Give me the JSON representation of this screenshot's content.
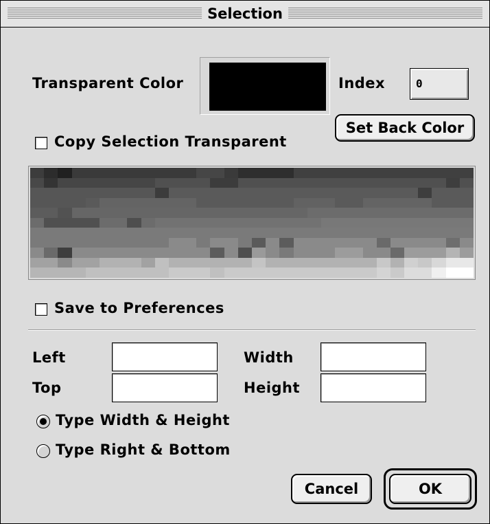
{
  "window": {
    "title": "Selection"
  },
  "transparent": {
    "label": "Transparent Color",
    "color": "#000000",
    "index_label": "Index",
    "index_value": "0",
    "set_back_color_label": "Set Back Color"
  },
  "copy_transparent": {
    "label": "Copy Selection Transparent",
    "checked": false
  },
  "preview": {
    "description": "pixelated grayscale gradient preview",
    "rows": [
      [
        "#3c3c3c",
        "#2c2c2c",
        "#202020",
        "#3a3a3a",
        "#3a3a3a",
        "#3a3a3a",
        "#3a3a3a",
        "#3a3a3a",
        "#3a3a3a",
        "#3a3a3a",
        "#3a3a3a",
        "#3a3a3a",
        "#464646",
        "#464646",
        "#3a3a3a",
        "#2e2e2e",
        "#2e2e2e",
        "#2e2e2e",
        "#2e2e2e",
        "#404040",
        "#404040",
        "#404040",
        "#404040",
        "#404040",
        "#404040",
        "#404040",
        "#404040",
        "#404040",
        "#404040",
        "#404040",
        "#404040",
        "#404040"
      ],
      [
        "#484848",
        "#343434",
        "#464646",
        "#464646",
        "#464646",
        "#464646",
        "#464646",
        "#464646",
        "#464646",
        "#505050",
        "#505050",
        "#505050",
        "#505050",
        "#3c3c3c",
        "#3c3c3c",
        "#505050",
        "#505050",
        "#505050",
        "#505050",
        "#505050",
        "#505050",
        "#505050",
        "#505050",
        "#505050",
        "#505050",
        "#505050",
        "#505050",
        "#505050",
        "#505050",
        "#505050",
        "#3e3e3e",
        "#505050"
      ],
      [
        "#565656",
        "#565656",
        "#565656",
        "#565656",
        "#565656",
        "#565656",
        "#565656",
        "#565656",
        "#565656",
        "#3c3c3c",
        "#5a5a5a",
        "#5a5a5a",
        "#5a5a5a",
        "#5a5a5a",
        "#5a5a5a",
        "#5a5a5a",
        "#5a5a5a",
        "#5a5a5a",
        "#5a5a5a",
        "#5a5a5a",
        "#5a5a5a",
        "#5a5a5a",
        "#5a5a5a",
        "#5a5a5a",
        "#5a5a5a",
        "#5a5a5a",
        "#5a5a5a",
        "#5a5a5a",
        "#3e3e3e",
        "#5a5a5a",
        "#5a5a5a",
        "#5a5a5a"
      ],
      [
        "#565656",
        "#565656",
        "#565656",
        "#565656",
        "#5a5a5a",
        "#646464",
        "#646464",
        "#646464",
        "#646464",
        "#646464",
        "#646464",
        "#646464",
        "#5a5a5a",
        "#5a5a5a",
        "#5a5a5a",
        "#5a5a5a",
        "#5a5a5a",
        "#5a5a5a",
        "#5a5a5a",
        "#626262",
        "#626262",
        "#626262",
        "#5a5a5a",
        "#5a5a5a",
        "#646464",
        "#646464",
        "#646464",
        "#646464",
        "#646464",
        "#5a5a5a",
        "#5a5a5a",
        "#5a5a5a"
      ],
      [
        "#5c5c5c",
        "#5c5c5c",
        "#525252",
        "#666666",
        "#666666",
        "#666666",
        "#666666",
        "#666666",
        "#666666",
        "#666666",
        "#666666",
        "#666666",
        "#666666",
        "#666666",
        "#666666",
        "#666666",
        "#666666",
        "#666666",
        "#666666",
        "#666666",
        "#6c6c6c",
        "#6c6c6c",
        "#6c6c6c",
        "#6c6c6c",
        "#6c6c6c",
        "#6c6c6c",
        "#6c6c6c",
        "#6c6c6c",
        "#6c6c6c",
        "#6c6c6c",
        "#6c6c6c",
        "#6c6c6c"
      ],
      [
        "#6c6c6c",
        "#505050",
        "#505050",
        "#505050",
        "#505050",
        "#6c6c6c",
        "#6c6c6c",
        "#4e4e4e",
        "#6c6c6c",
        "#727272",
        "#727272",
        "#727272",
        "#727272",
        "#727272",
        "#727272",
        "#727272",
        "#727272",
        "#727272",
        "#727272",
        "#727272",
        "#727272",
        "#787878",
        "#787878",
        "#787878",
        "#787878",
        "#787878",
        "#787878",
        "#787878",
        "#787878",
        "#787878",
        "#787878",
        "#787878"
      ],
      [
        "#7a7a7a",
        "#7a7a7a",
        "#7a7a7a",
        "#7a7a7a",
        "#7a7a7a",
        "#7a7a7a",
        "#7a7a7a",
        "#7a7a7a",
        "#7a7a7a",
        "#7a7a7a",
        "#7a7a7a",
        "#7a7a7a",
        "#7a7a7a",
        "#7a7a7a",
        "#7a7a7a",
        "#7a7a7a",
        "#7a7a7a",
        "#7a7a7a",
        "#7a7a7a",
        "#7a7a7a",
        "#7a7a7a",
        "#7a7a7a",
        "#7a7a7a",
        "#7a7a7a",
        "#7a7a7a",
        "#7a7a7a",
        "#7a7a7a",
        "#7a7a7a",
        "#7a7a7a",
        "#7a7a7a",
        "#7a7a7a",
        "#7a7a7a"
      ],
      [
        "#7a7a7a",
        "#7a7a7a",
        "#7a7a7a",
        "#7a7a7a",
        "#7a7a7a",
        "#7a7a7a",
        "#7a7a7a",
        "#7a7a7a",
        "#7a7a7a",
        "#7a7a7a",
        "#8a8a8a",
        "#8a8a8a",
        "#7a7a7a",
        "#8a8a8a",
        "#8a8a8a",
        "#7a7a7a",
        "#5a5a5a",
        "#8a8a8a",
        "#5c5c5c",
        "#8a8a8a",
        "#8a8a8a",
        "#8a8a8a",
        "#8a8a8a",
        "#8a8a8a",
        "#8a8a8a",
        "#6a6a6a",
        "#8a8a8a",
        "#8a8a8a",
        "#8a8a8a",
        "#8a8a8a",
        "#6e6e6e",
        "#8a8a8a"
      ],
      [
        "#8a8a8a",
        "#6a6a6a",
        "#3e3e3e",
        "#8a8a8a",
        "#8a8a8a",
        "#8a8a8a",
        "#8a8a8a",
        "#8a8a8a",
        "#8a8a8a",
        "#8a8a8a",
        "#8a8a8a",
        "#8a8a8a",
        "#8a8a8a",
        "#5c5c5c",
        "#8a8a8a",
        "#4e4e4e",
        "#9a9a9a",
        "#8a8a8a",
        "#7a7a7a",
        "#8a8a8a",
        "#8a8a8a",
        "#8a8a8a",
        "#9c9c9c",
        "#9c9c9c",
        "#8a8a8a",
        "#8a8a8a",
        "#6a6a6a",
        "#9c9c9c",
        "#9c9c9c",
        "#9c9c9c",
        "#b4b4b4",
        "#9c9c9c"
      ],
      [
        "#a2a2a2",
        "#a2a2a2",
        "#8a8a8a",
        "#a2a2a2",
        "#a2a2a2",
        "#b2b2b2",
        "#b2b2b2",
        "#b2b2b2",
        "#a2a2a2",
        "#c0c0c0",
        "#b2b2b2",
        "#b2b2b2",
        "#b2b2b2",
        "#b2b2b2",
        "#b2b2b2",
        "#b2b2b2",
        "#c4c4c4",
        "#b2b2b2",
        "#b2b2b2",
        "#b2b2b2",
        "#b2b2b2",
        "#b2b2b2",
        "#b2b2b2",
        "#b2b2b2",
        "#b2b2b2",
        "#c8c8c8",
        "#b2b2b2",
        "#d0d0d0",
        "#c8c8c8",
        "#d8d8d8",
        "#e8e8e8",
        "#e8e8e8"
      ],
      [
        "#b6b6b6",
        "#b6b6b6",
        "#b6b6b6",
        "#b6b6b6",
        "#c0c0c0",
        "#c0c0c0",
        "#c0c0c0",
        "#c0c0c0",
        "#c0c0c0",
        "#c0c0c0",
        "#cacaca",
        "#cacaca",
        "#cacaca",
        "#c0c0c0",
        "#cacaca",
        "#cacaca",
        "#cacaca",
        "#cacaca",
        "#cacaca",
        "#cacaca",
        "#cacaca",
        "#cacaca",
        "#cacaca",
        "#cacaca",
        "#cacaca",
        "#d4d4d4",
        "#cacaca",
        "#dcdcdc",
        "#dcdcdc",
        "#f0f0f0",
        "#ffffff",
        "#ffffff"
      ]
    ]
  },
  "save_prefs": {
    "label": "Save to Preferences",
    "checked": false
  },
  "coords": {
    "left_label": "Left",
    "top_label": "Top",
    "width_label": "Width",
    "height_label": "Height",
    "left_value": "",
    "top_value": "",
    "width_value": "",
    "height_value": ""
  },
  "mode": {
    "option1_label": "Type Width & Height",
    "option2_label": "Type Right & Bottom",
    "selected": "option1"
  },
  "buttons": {
    "cancel_label": "Cancel",
    "ok_label": "OK"
  }
}
